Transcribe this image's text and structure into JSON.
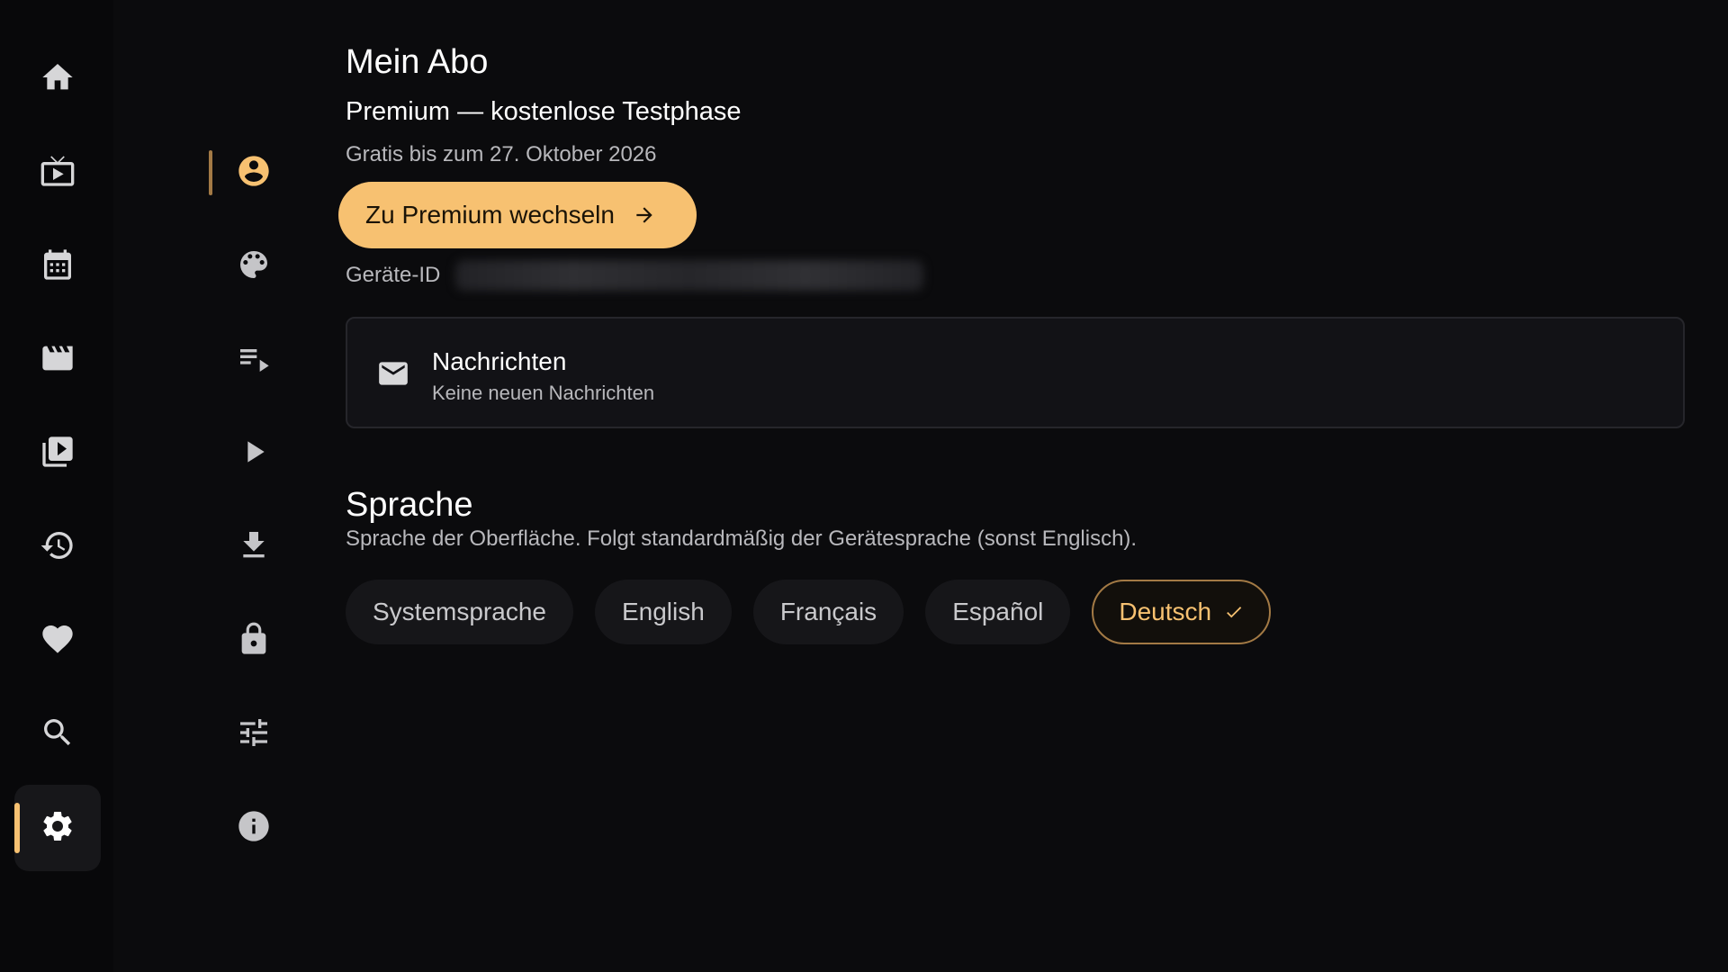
{
  "nav": {
    "items": [
      {
        "icon": "home-icon"
      },
      {
        "icon": "live-tv-icon"
      },
      {
        "icon": "calendar-icon"
      },
      {
        "icon": "movie-icon"
      },
      {
        "icon": "video-library-icon"
      },
      {
        "icon": "history-icon"
      },
      {
        "icon": "favorite-icon"
      },
      {
        "icon": "search-icon"
      },
      {
        "icon": "settings-icon",
        "active": true
      }
    ]
  },
  "settings_nav": {
    "items": [
      {
        "icon": "account-icon",
        "active": true
      },
      {
        "icon": "palette-icon"
      },
      {
        "icon": "playlist-play-icon"
      },
      {
        "icon": "play-icon"
      },
      {
        "icon": "download-icon"
      },
      {
        "icon": "lock-icon"
      },
      {
        "icon": "tune-icon"
      },
      {
        "icon": "info-icon"
      }
    ]
  },
  "subscription": {
    "title": "Mein Abo",
    "plan": "Premium — kostenlose Testphase",
    "free_until": "Gratis bis zum 27. Oktober 2026",
    "upgrade_label": "Zu Premium wechseln",
    "device_id_label": "Geräte-ID"
  },
  "messages": {
    "title": "Nachrichten",
    "subtitle": "Keine neuen Nachrichten"
  },
  "language": {
    "title": "Sprache",
    "description": "Sprache der Oberfläche. Folgt standardmäßig der Gerätesprache (sonst Englisch).",
    "options": [
      "Systemsprache",
      "English",
      "Français",
      "Español",
      "Deutsch"
    ],
    "selected": "Deutsch"
  },
  "colors": {
    "accent": "#f7c171",
    "background": "#0b0b0d"
  }
}
